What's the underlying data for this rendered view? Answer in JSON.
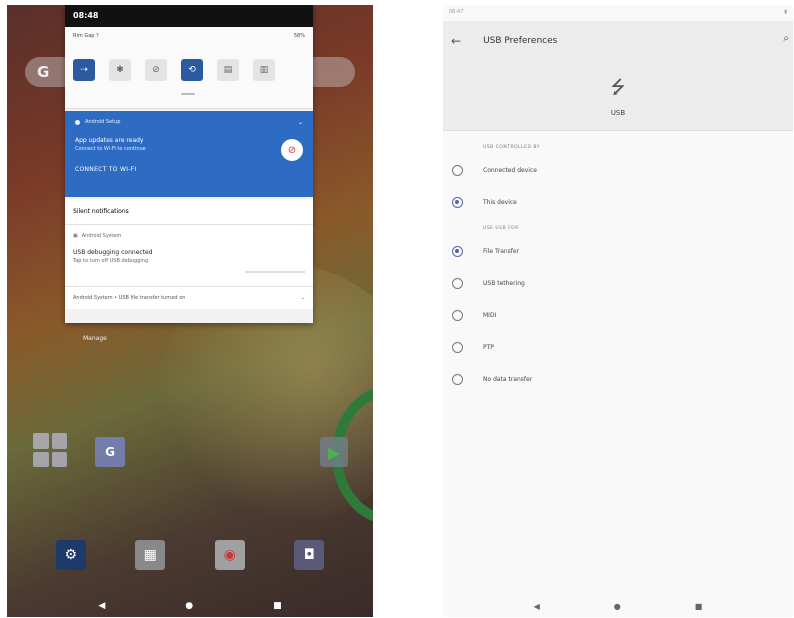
{
  "left": {
    "shade": {
      "time": "08:48",
      "network": "Rim Gap ?",
      "battery": "58%",
      "tiles": [
        {
          "icon": "wifi-icon",
          "glyph": "⇢",
          "on": true
        },
        {
          "icon": "bluetooth-icon",
          "glyph": "✱",
          "on": false
        },
        {
          "icon": "dnd-icon",
          "glyph": "⊘",
          "on": false
        },
        {
          "icon": "rotate-icon",
          "glyph": "⟲",
          "on": true
        },
        {
          "icon": "cast-icon",
          "glyph": "▤",
          "on": false
        },
        {
          "icon": "battery-saver-icon",
          "glyph": "▥",
          "on": false
        }
      ]
    },
    "wifi_notification": {
      "app": "Android Setup",
      "title": "App updates are ready",
      "subtitle": "Connect to Wi-Fi to continue",
      "action": "CONNECT TO WI-FI"
    },
    "silent_label": "Silent notifications",
    "usb_notification": {
      "app": "Android System",
      "title": "USB debugging connected",
      "subtitle": "Tap to turn off USB debugging"
    },
    "android_system_text": "Android System • USB file transfer turned on",
    "manage_label": "Manage",
    "news_glyph": "G",
    "play_glyph": "▶",
    "dock": [
      {
        "name": "settings-icon",
        "glyph": "⚙",
        "cls": "d-settings"
      },
      {
        "name": "gallery-icon",
        "glyph": "▦",
        "cls": "d-gallery"
      },
      {
        "name": "chrome-icon",
        "glyph": "◉",
        "cls": "d-chrome"
      },
      {
        "name": "camera-icon",
        "glyph": "◘",
        "cls": "d-camera"
      }
    ],
    "nav": {
      "back": "◀",
      "home": "●",
      "recents": "■"
    }
  },
  "right": {
    "status_time": "08:47",
    "status_icons": "▮",
    "title": "USB Preferences",
    "header_label": "USB",
    "section1": "USB CONTROLLED BY",
    "controlled_by": [
      {
        "label": "Connected device",
        "selected": false
      },
      {
        "label": "This device",
        "selected": true
      }
    ],
    "section2": "USE USB FOR",
    "use_for": [
      {
        "label": "File Transfer",
        "selected": true
      },
      {
        "label": "USB tethering",
        "selected": false
      },
      {
        "label": "MIDI",
        "selected": false
      },
      {
        "label": "PTP",
        "selected": false
      },
      {
        "label": "No data transfer",
        "selected": false
      }
    ],
    "nav": {
      "back": "◀",
      "home": "●",
      "recents": "■"
    }
  },
  "colors": {
    "accent_blue": "#2e6cc4",
    "radio_selected": "#5566aa"
  }
}
